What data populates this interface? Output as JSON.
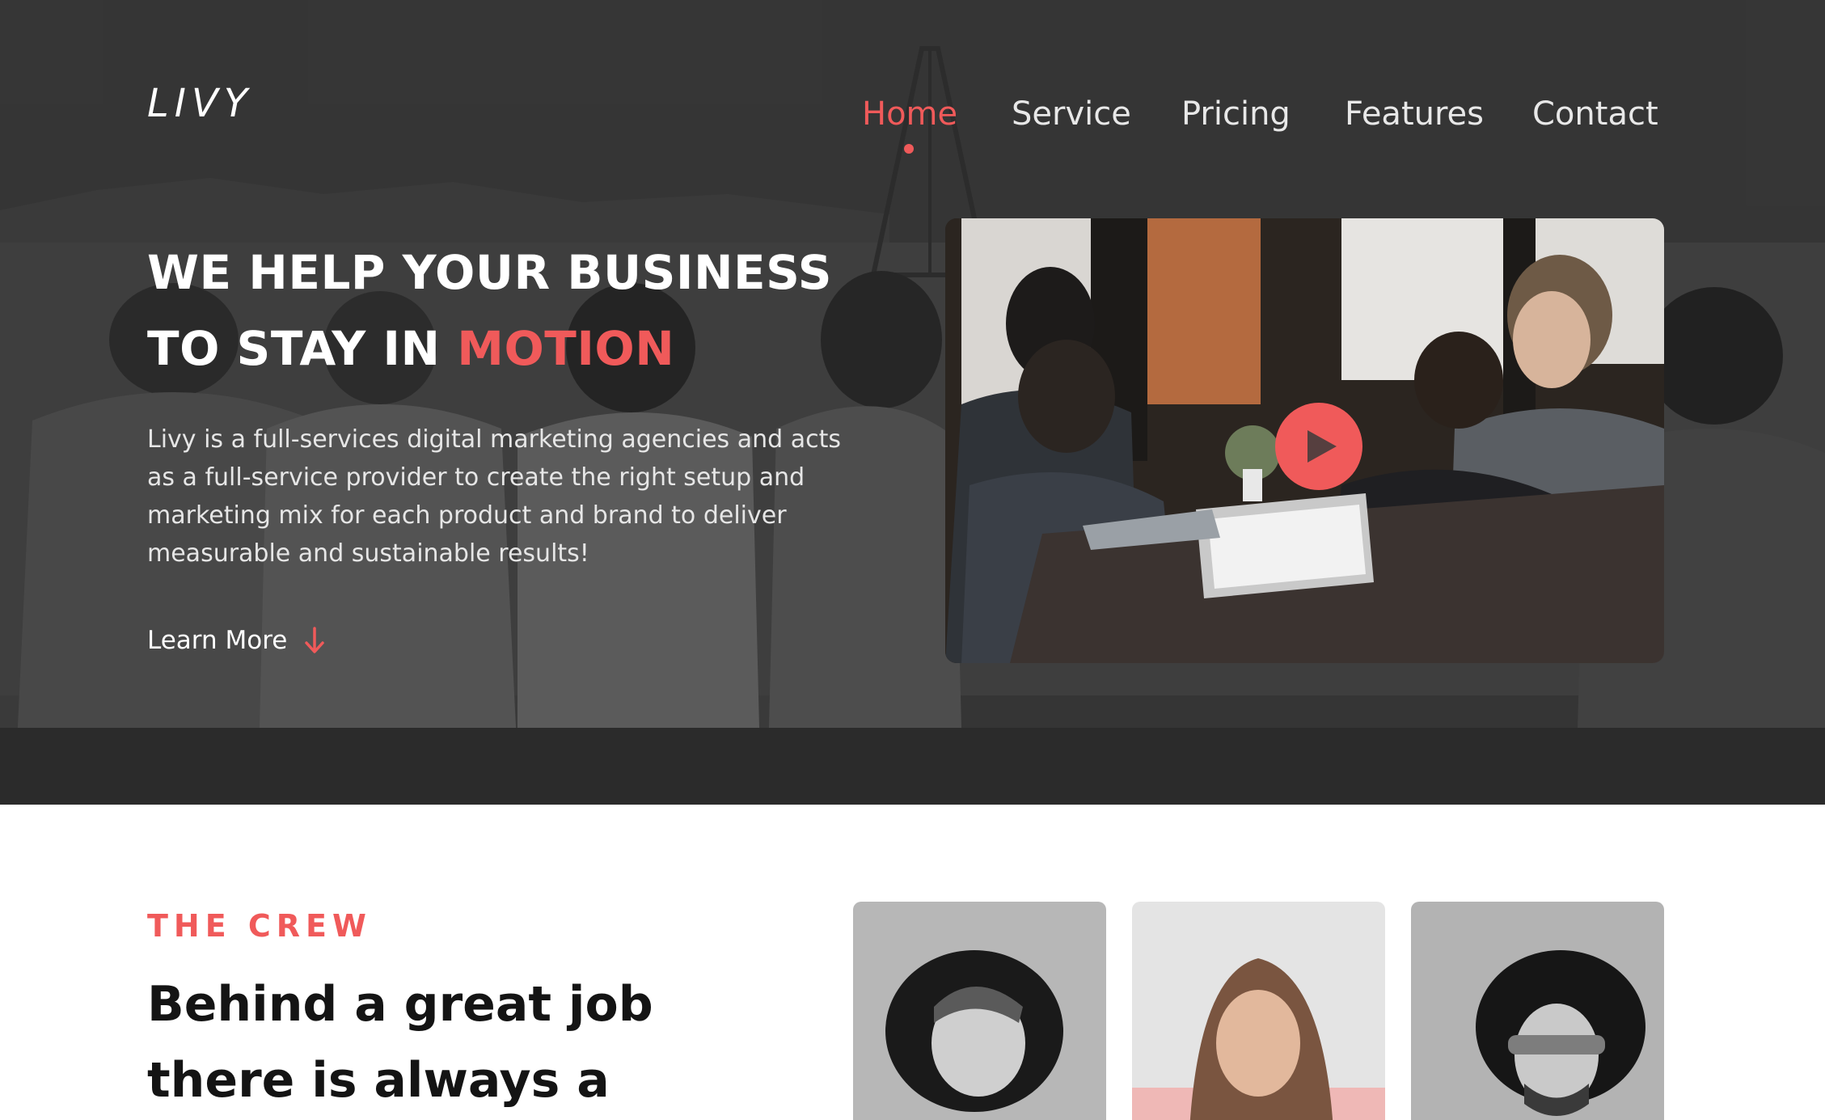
{
  "brand": {
    "logo": "LIVY"
  },
  "nav": {
    "items": [
      {
        "label": "Home",
        "active": true
      },
      {
        "label": "Service",
        "active": false
      },
      {
        "label": "Pricing",
        "active": false
      },
      {
        "label": "Features",
        "active": false
      },
      {
        "label": "Contact",
        "active": false
      }
    ]
  },
  "hero": {
    "headline_line1": "WE HELP YOUR BUSINESS",
    "headline_line2_prefix": "TO STAY IN ",
    "headline_line2_accent": "MOTION",
    "description": "Livy is a full-services digital marketing agencies and acts as a full-service provider to create the right setup and marketing mix for each product and brand to deliver measurable and sustainable results!",
    "cta_label": "Learn More",
    "cta_icon": "arrow-down-icon",
    "video_icon": "play-icon"
  },
  "crew": {
    "eyebrow": "THE CREW",
    "title_line1": "Behind a great job",
    "title_line2": "there is always a"
  },
  "colors": {
    "accent": "#f05a5a",
    "hero_bg": "#3b3b3b",
    "text_dark": "#141414",
    "text_light": "#ffffff"
  }
}
